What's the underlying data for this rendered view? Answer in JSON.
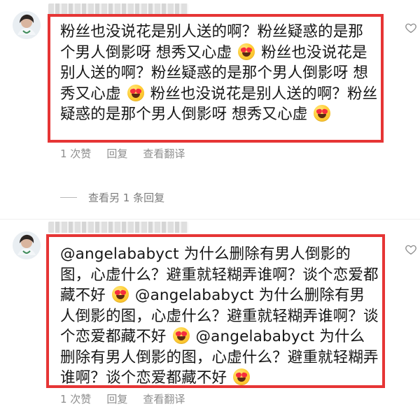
{
  "comments": [
    {
      "text": [
        "粉丝也没说花是别人送的啊？粉丝疑惑的是那个男人倒影呀 想秀又心虚",
        "粉丝也没说花是别人送的啊？粉丝疑惑的是那个男人倒影呀 想秀又心虚",
        "粉丝也没说花是别人送的啊？粉丝疑惑的是那个男人倒影呀 想秀又心虚"
      ],
      "likes": "1 次赞",
      "reply": "回复",
      "translate": "查看翻译",
      "view_replies": "查看另 1 条回复"
    },
    {
      "text": [
        "@angelababyct 为什么删除有男人倒影的图，心虚什么？避重就轻糊弄谁啊？谈个恋爱都藏不好",
        "@angelababyct 为什么删除有男人倒影的图，心虚什么？避重就轻糊弄谁啊？谈个恋爱都藏不好",
        "@angelababyct 为什么删除有男人倒影的图，心虚什么？避重就轻糊弄谁啊？谈个恋爱都藏不好"
      ],
      "likes": "1 次赞",
      "reply": "回复",
      "translate": "查看翻译"
    }
  ],
  "icons": {
    "avatar": "avatar",
    "like": "heart-icon",
    "emoji": "heart-eyes-emoji"
  },
  "colors": {
    "highlight_border": "#e63535",
    "meta_text": "#8e8e8e",
    "emoji_face": "#ffcf3a",
    "emoji_eyes": "#f52d3d"
  }
}
